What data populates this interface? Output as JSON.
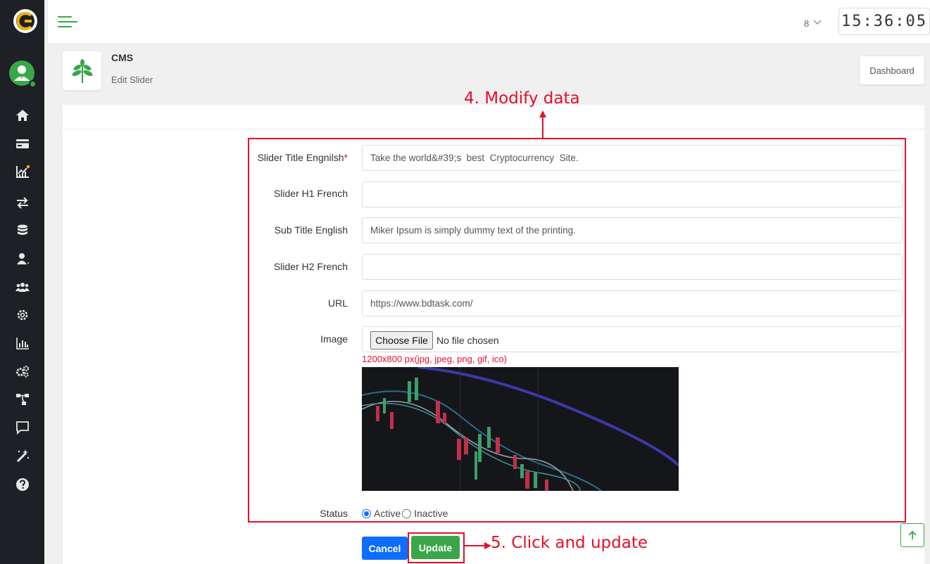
{
  "header": {
    "language": "8",
    "clock": "15:36:05"
  },
  "page": {
    "title": "CMS",
    "subtitle": "Edit Slider",
    "dashboard_button": "Dashboard"
  },
  "form": {
    "fields": [
      {
        "label": "Slider Title Engnilsh",
        "required": true,
        "value": "Take the world&#39;s  best  Cryptocurrency  Site."
      },
      {
        "label": "Slider H1 French",
        "required": false,
        "value": ""
      },
      {
        "label": "Sub Title English",
        "required": false,
        "value": "Miker Ipsum is simply dummy text of the printing."
      },
      {
        "label": "Slider H2 French",
        "required": false,
        "value": ""
      },
      {
        "label": "URL",
        "required": false,
        "value": "https://www.bdtask.com/"
      }
    ],
    "image": {
      "label": "Image",
      "choose_button": "Choose File",
      "file_text": "No file chosen",
      "hint": "1200x800 px(jpg, jpeg, png, gif, ico)"
    },
    "status": {
      "label": "Status",
      "options": [
        "Active",
        "Inactive"
      ],
      "selected": "Active"
    },
    "cancel_label": "Cancel",
    "update_label": "Update"
  },
  "annotations": {
    "step4": "4. Modify data",
    "step5": "5. Click and update"
  },
  "colors": {
    "brand_green": "#3aa64a",
    "sidebar_bg": "#1d2025",
    "annotation_red": "#e3102b",
    "primary_blue": "#0d6efd"
  },
  "icons": {
    "sidebar": [
      "home-icon",
      "card-icon",
      "chart-icon",
      "exchange-icon",
      "coins-icon",
      "user-icon",
      "users-icon",
      "gear-icon",
      "bar-chart-icon",
      "gears-icon",
      "sitemap-icon",
      "chat-icon",
      "magic-icon",
      "help-icon"
    ]
  }
}
